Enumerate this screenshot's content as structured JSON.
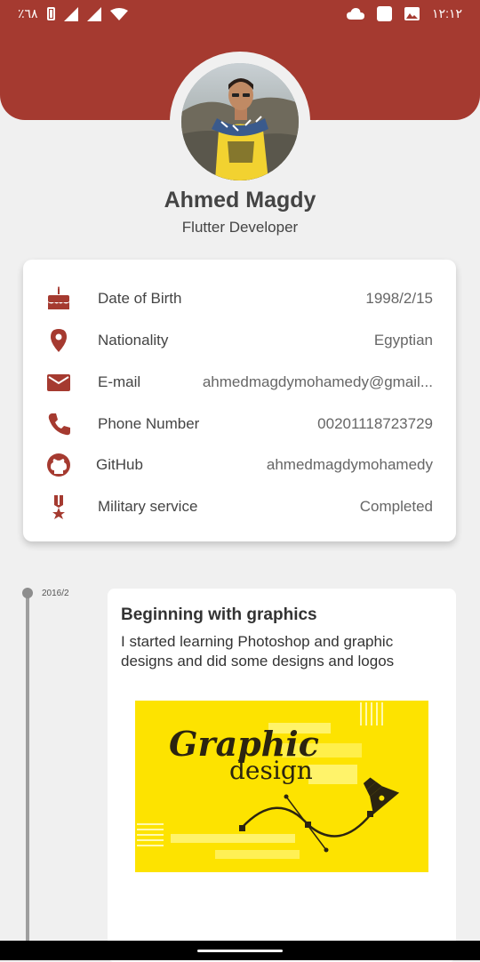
{
  "status_bar": {
    "battery_text": "٪٦٨",
    "time": "١٢:١٢"
  },
  "profile": {
    "name": "Ahmed Magdy",
    "title": "Flutter Developer"
  },
  "info": {
    "items": [
      {
        "icon": "cake-icon",
        "label": "Date of Birth",
        "value": "1998/2/15"
      },
      {
        "icon": "location-pin-icon",
        "label": "Nationality",
        "value": "Egyptian"
      },
      {
        "icon": "mail-icon",
        "label": "E-mail",
        "value": "ahmedmagdymohamedy@gmail..."
      },
      {
        "icon": "phone-icon",
        "label": "Phone Number",
        "value": "00201118723729"
      },
      {
        "icon": "github-icon",
        "label": "GitHub",
        "value": "ahmedmagdymohamedy"
      },
      {
        "icon": "military-medal-icon",
        "label": "Military service",
        "value": "Completed"
      }
    ]
  },
  "timeline": {
    "date": "2016/2",
    "event": {
      "title": "Beginning with graphics",
      "description": "I started learning Photoshop and graphic designs and did some designs and logos",
      "image": {
        "word1": "Graphic",
        "word2": "design"
      }
    }
  },
  "colors": {
    "accent": "#a53a30",
    "background": "#f0f0f0",
    "image_yellow": "#fde300"
  }
}
